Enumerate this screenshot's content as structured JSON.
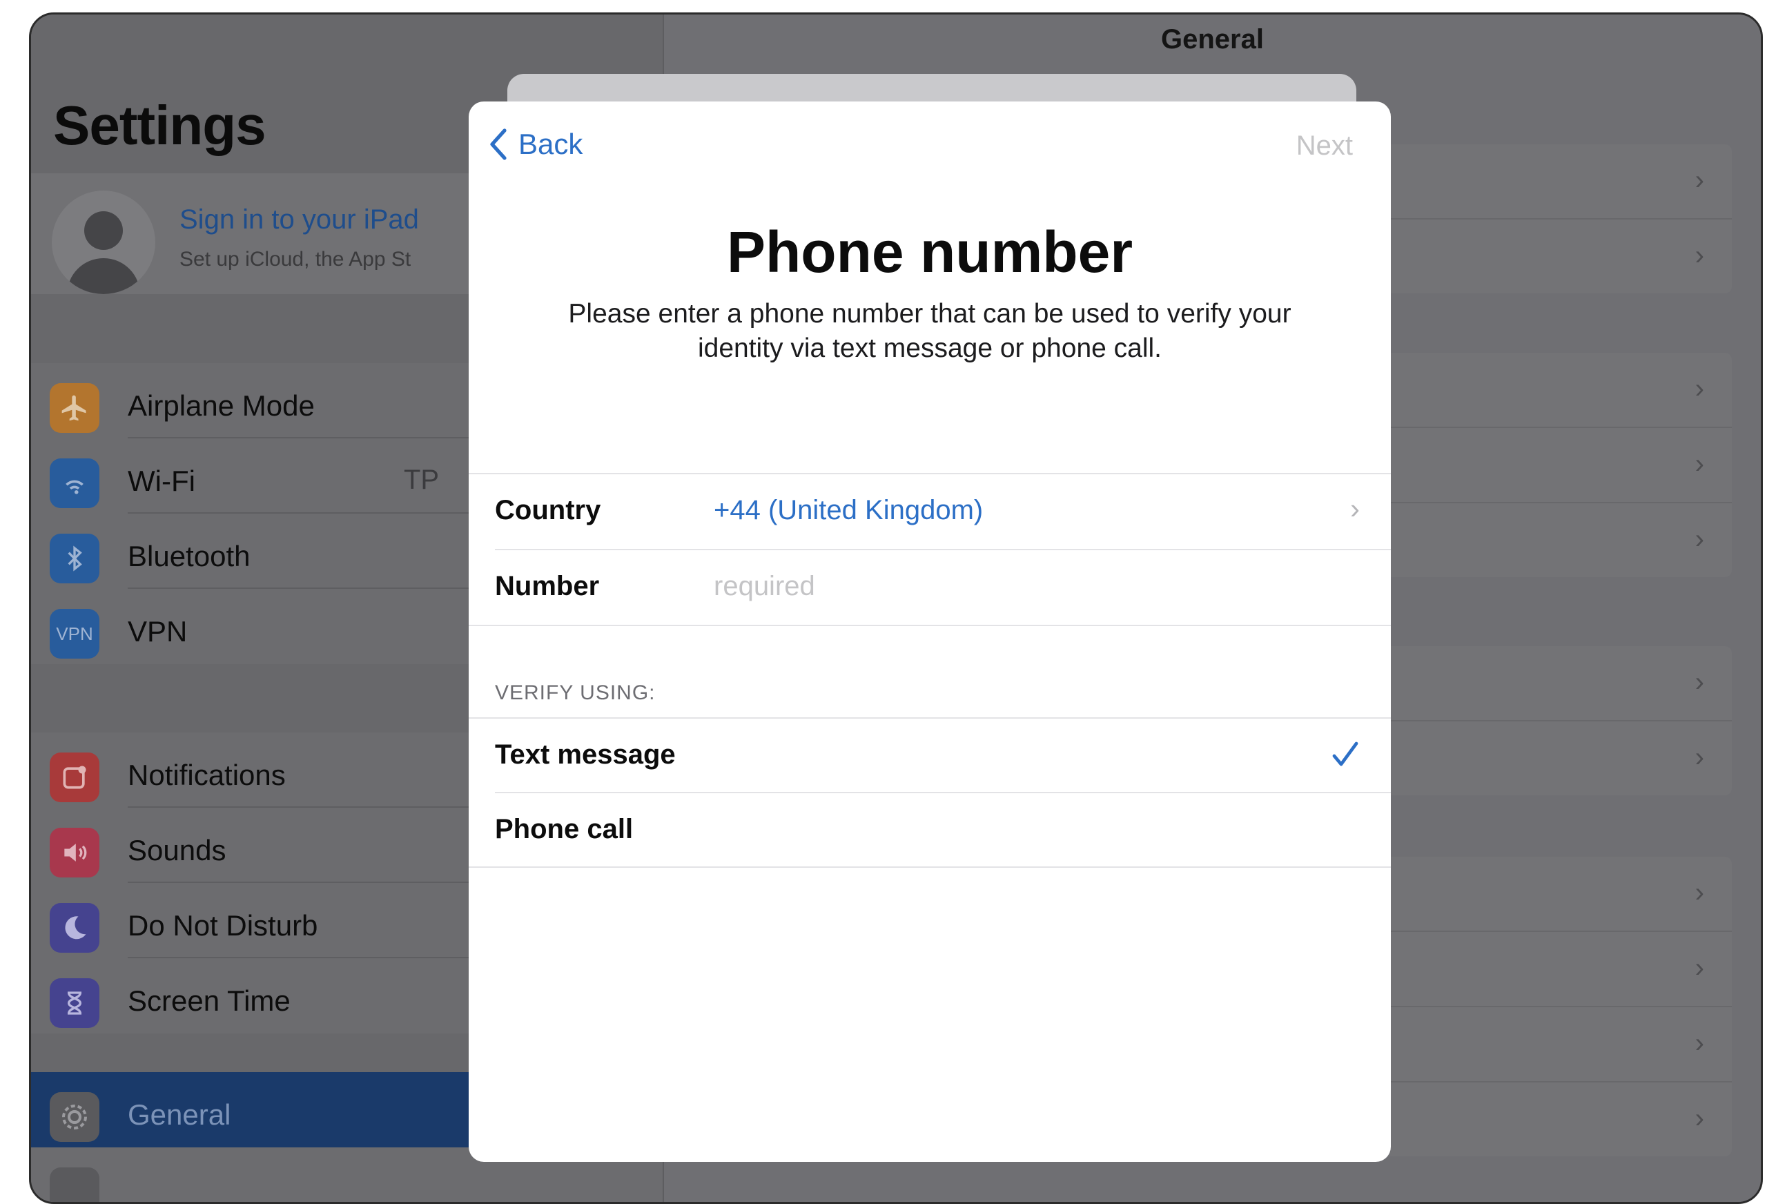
{
  "sidebar": {
    "title": "Settings",
    "profile": {
      "signin": "Sign in to your iPad",
      "subtitle": "Set up iCloud, the App St"
    },
    "group1": [
      {
        "label": "Airplane Mode",
        "icon": "airplane-icon",
        "color": "#b3752e"
      },
      {
        "label": "Wi-Fi",
        "icon": "wifi-icon",
        "color": "#285c9c",
        "value": "TP"
      },
      {
        "label": "Bluetooth",
        "icon": "bluetooth-icon",
        "color": "#285c9c"
      },
      {
        "label": "VPN",
        "icon": "vpn-icon",
        "color": "#285c9c",
        "icon_text": "VPN"
      }
    ],
    "group2": [
      {
        "label": "Notifications",
        "icon": "notifications-icon",
        "color": "#a83a3a"
      },
      {
        "label": "Sounds",
        "icon": "sounds-icon",
        "color": "#a8384d"
      },
      {
        "label": "Do Not Disturb",
        "icon": "moon-icon",
        "color": "#45438f"
      },
      {
        "label": "Screen Time",
        "icon": "hourglass-icon",
        "color": "#45438f"
      }
    ],
    "group3": [
      {
        "label": "General",
        "icon": "gear-icon",
        "color": "#5a5a5d",
        "selected": true
      }
    ]
  },
  "detail": {
    "title": "General"
  },
  "modal": {
    "back_label": "Back",
    "next_label": "Next",
    "heading": "Phone number",
    "description": "Please enter a phone number that can be used to verify your identity via text message or phone call.",
    "country_label": "Country",
    "country_value": "+44 (United Kingdom)",
    "number_label": "Number",
    "number_placeholder": "required",
    "verify_header": "VERIFY USING:",
    "options": [
      {
        "label": "Text message",
        "checked": true
      },
      {
        "label": "Phone call",
        "checked": false
      }
    ],
    "accent_color": "#2c6fc6"
  }
}
